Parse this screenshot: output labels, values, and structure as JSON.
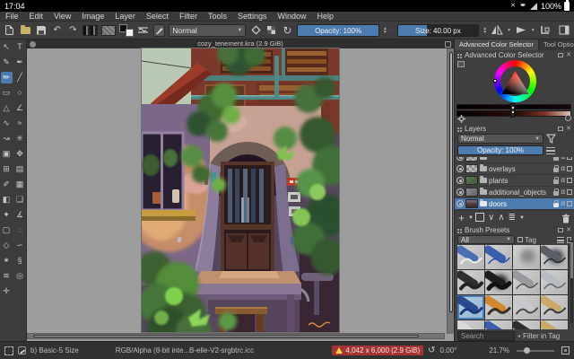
{
  "android_bar": {
    "time": "17:04",
    "battery_pct": "100%"
  },
  "menu_bar": {
    "items": [
      "File",
      "Edit",
      "View",
      "Image",
      "Layer",
      "Select",
      "Filter",
      "Tools",
      "Settings",
      "Window",
      "Help"
    ]
  },
  "toolbar": {
    "blending_mode": "Normal",
    "opacity_label": "Opacity: 100%",
    "size_label": "Size: 40.00 px",
    "size_fill_pct": 36
  },
  "document_tab": {
    "title": "cozy_tenement.kra (2.9 GiB)"
  },
  "toolbox": {
    "tools": [
      {
        "name": "select-shapes",
        "glyph": "↖"
      },
      {
        "name": "text",
        "glyph": "T"
      },
      {
        "name": "edit-shapes",
        "glyph": "✎"
      },
      {
        "name": "calligraphy",
        "glyph": "✒"
      },
      {
        "name": "freehand-brush",
        "glyph": "✏",
        "selected": true
      },
      {
        "name": "line",
        "glyph": "╱"
      },
      {
        "name": "rectangle",
        "glyph": "▭"
      },
      {
        "name": "ellipse",
        "glyph": "○"
      },
      {
        "name": "polygon",
        "glyph": "△"
      },
      {
        "name": "polyline",
        "glyph": "∠"
      },
      {
        "name": "bezier-curve",
        "glyph": "∿"
      },
      {
        "name": "freehand-path",
        "glyph": "≈"
      },
      {
        "name": "dynamic-brush",
        "glyph": "↝"
      },
      {
        "name": "multibrush",
        "glyph": "✳"
      },
      {
        "name": "transform",
        "glyph": "▣"
      },
      {
        "name": "move",
        "glyph": "✥"
      },
      {
        "name": "crop",
        "glyph": "⊞"
      },
      {
        "name": "gradient",
        "glyph": "▤"
      },
      {
        "name": "color-sampler",
        "glyph": "✐"
      },
      {
        "name": "pattern-edit",
        "glyph": "▦"
      },
      {
        "name": "fill",
        "glyph": "◧"
      },
      {
        "name": "smart-patch",
        "glyph": "❏"
      },
      {
        "name": "assistants",
        "glyph": "✦"
      },
      {
        "name": "measure",
        "glyph": "∡"
      },
      {
        "name": "rect-select",
        "glyph": "▢"
      },
      {
        "name": "ellipse-select",
        "glyph": "◌"
      },
      {
        "name": "polygon-select",
        "glyph": "◇"
      },
      {
        "name": "freehand-select",
        "glyph": "∽"
      },
      {
        "name": "similar-select",
        "glyph": "✶"
      },
      {
        "name": "bezier-select",
        "glyph": "§"
      },
      {
        "name": "magnetic-select",
        "glyph": "≋"
      },
      {
        "name": "zoom",
        "glyph": "◎"
      },
      {
        "name": "pan",
        "glyph": "✛"
      }
    ]
  },
  "right_panel": {
    "tabs": [
      {
        "label": "Advanced Color Selector",
        "active": true
      },
      {
        "label": "Tool Options",
        "active": false
      }
    ],
    "color_selector": {
      "title": "Advanced Color Selector"
    },
    "layers": {
      "title": "Layers",
      "blending_mode": "Normal",
      "opacity_label": "Opacity: 100%",
      "rows": [
        {
          "name": ""
        },
        {
          "name": "overlays"
        },
        {
          "name": "plants"
        },
        {
          "name": "additional_objects"
        },
        {
          "name": "doors",
          "selected": true
        }
      ]
    },
    "brush_presets": {
      "title": "Brush Presets",
      "filter_value": "All",
      "tag_label": "Tag",
      "search_placeholder": "Search",
      "filter_in_tag_label": "Filter in Tag",
      "cells": [
        {
          "name": "eraser-soft",
          "tool": "#4a6fb5",
          "stroke": "#ececec",
          "w": 2
        },
        {
          "name": "ink-pen-blue",
          "tool": "#3a5fae",
          "stroke": "#2a4faa",
          "w": 1.5
        },
        {
          "name": "airbrush-soft",
          "blob": "#8a8a8a"
        },
        {
          "name": "ink-pen-dark",
          "tool": "#5a5f66",
          "stroke": "#23272e",
          "blob": "#3a3f46",
          "w": 1.5
        },
        {
          "name": "charcoal",
          "tool": "#2e2e30",
          "stroke": "#222222",
          "w": 4
        },
        {
          "name": "brush-bold-black",
          "tool": "#1e1e20",
          "stroke": "#111111",
          "blob": "#222222",
          "w": 5
        },
        {
          "name": "pencil-gray",
          "tool": "#9a9a9e",
          "stroke": "#555555",
          "w": 1.5
        },
        {
          "name": "pen-silver",
          "tool": "#b8bcc2",
          "stroke": "#666666",
          "w": 1.5
        },
        {
          "name": "wet-paint-blue",
          "tool": "#2a4a8e",
          "stroke": "#1d3a7a",
          "w": 3,
          "selected": true
        },
        {
          "name": "brush-orange-handle",
          "tool": "#d2862e",
          "stroke": "#3a2e26",
          "w": 3
        },
        {
          "name": "brush-fine",
          "tool": "#c8c8cc",
          "stroke": "#4a4a50",
          "w": 2
        },
        {
          "name": "pencil-graphite",
          "tool": "#caa86a",
          "stroke": "#3c3c40",
          "w": 2
        },
        {
          "name": "partial-light",
          "tool": "#d8d8d8",
          "stroke": "#bbbbbb",
          "w": 2
        },
        {
          "name": "partial-blue",
          "tool": "#3a5fae",
          "stroke": "#2a4faa",
          "w": 2
        },
        {
          "name": "partial-dark",
          "tool": "#2e2e30",
          "stroke": "#222222",
          "w": 2
        },
        {
          "name": "partial-tan",
          "tool": "#caa86a",
          "stroke": "#8a6a3a",
          "w": 2
        }
      ]
    }
  },
  "status_bar": {
    "brush_name": "b) Basic-5 Size",
    "color_profile": "RGB/Alpha (8-bit inte...B-elle-V2-srgbtrc.icc",
    "memory_warning": "4,042 x 6,000 (2.9 GiB)",
    "rotation": "0.00°",
    "zoom_pct": "21.7%"
  },
  "colors": {
    "accent_blue": "#4c7bb0",
    "ui_bg": "#3d3d3d",
    "panel_bg": "#3f3f3f",
    "canvas_surround": "#9d9d9d",
    "warning_bg": "#a23434",
    "statusbar_bg": "#323232"
  }
}
